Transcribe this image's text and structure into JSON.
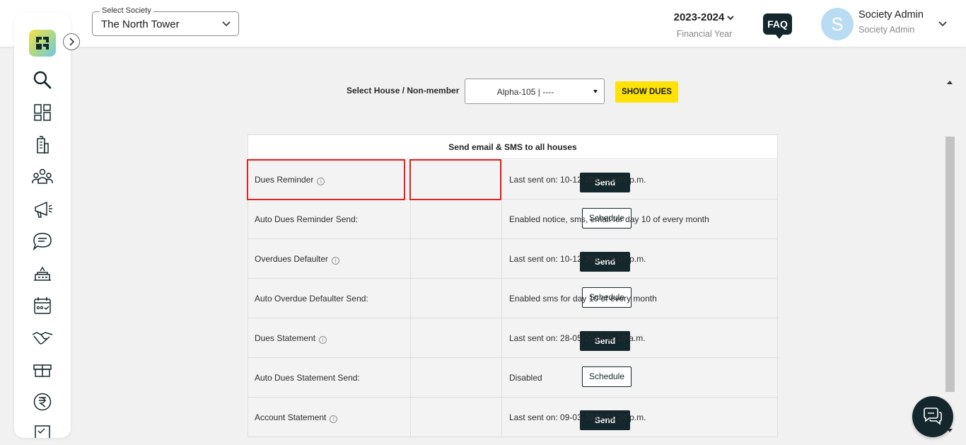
{
  "header": {
    "society_label": "Select Society",
    "society_value": "The North Tower",
    "financial_year": "2023-2024",
    "financial_year_label": "Financial Year",
    "faq": "FAQ",
    "avatar_initial": "S",
    "user_name": "Society Admin",
    "user_role": "Society Admin"
  },
  "sidebar": {
    "icons": [
      "logo-icon",
      "search-icon",
      "dashboard-icon",
      "building-icon",
      "members-icon",
      "announcement-icon",
      "chat-icon",
      "facility-icon",
      "calendar-icon",
      "handshake-icon",
      "gift-icon",
      "rupee-icon",
      "checklist-icon"
    ]
  },
  "filter": {
    "house_label": "Select House / Non-member",
    "house_value": "Alpha-105 | ----",
    "show_dues": "SHOW DUES"
  },
  "panel": {
    "title": "Send email & SMS to all houses",
    "rows": [
      {
        "label": "Dues Reminder",
        "info": true,
        "action": "Send",
        "status": "Last sent on: 10-12-2024 06:07 p.m."
      },
      {
        "label": "Auto Dues Reminder Send:",
        "info": false,
        "action": "Schedule",
        "status": "Enabled notice, sms, email for day 10 of every month"
      },
      {
        "label": "Overdues Defaulter",
        "info": true,
        "action": "Send",
        "status": "Last sent on: 10-12-2024 06:07 p.m."
      },
      {
        "label": "Auto Overdue Defaulter Send:",
        "info": false,
        "action": "Schedule",
        "status": "Enabled sms for day 10 of every month"
      },
      {
        "label": "Dues Statement",
        "info": true,
        "action": "Send",
        "status": "Last sent on: 28-05-2024 11:10 a.m."
      },
      {
        "label": "Auto Dues Statement Send:",
        "info": false,
        "action": "Schedule",
        "status": "Disabled"
      },
      {
        "label": "Account Statement",
        "info": true,
        "action": "Send",
        "status": "Last sent on: 09-03-2021 01:24 p.m."
      }
    ]
  },
  "colors": {
    "accent_dark": "#13272c",
    "accent_yellow": "#fde20a",
    "highlight_red": "#e02424"
  }
}
